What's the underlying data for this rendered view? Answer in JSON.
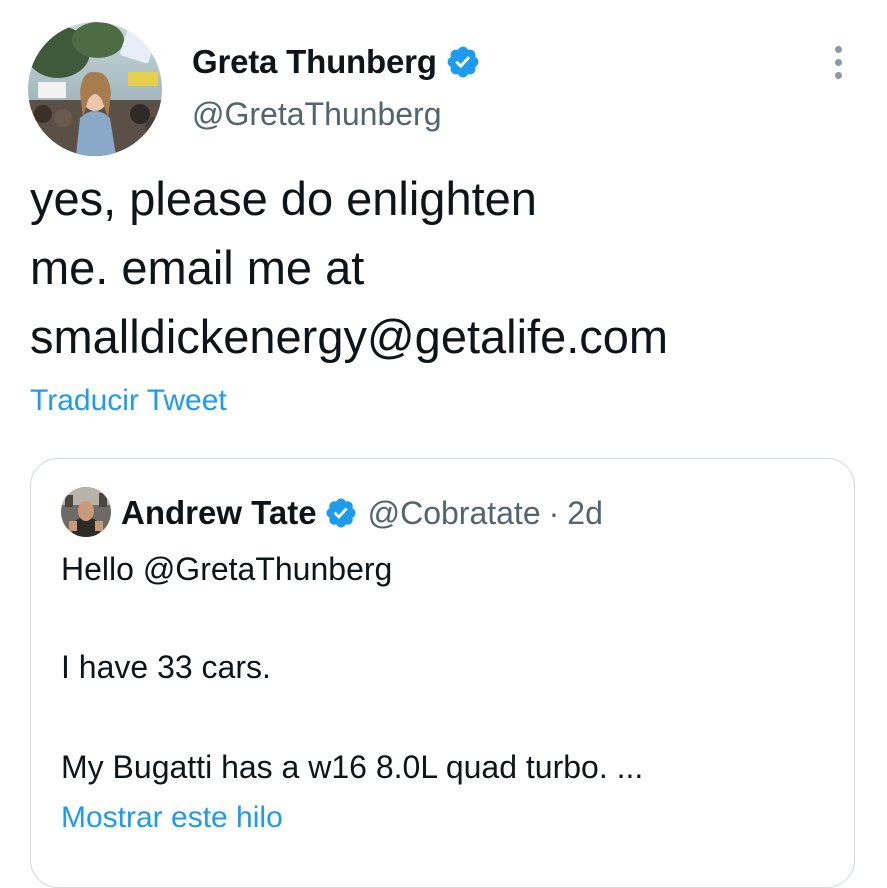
{
  "tweet": {
    "author": {
      "display_name": "Greta Thunberg",
      "handle": "@GretaThunberg",
      "verified": true,
      "avatar_icon": "profile-photo"
    },
    "text_lines": [
      "yes, please do enlighten",
      "me. email me at",
      "smalldickenergy@getalife.com"
    ],
    "translate_label": "Traducir Tweet",
    "more_icon": "more-vertical-icon"
  },
  "quoted_tweet": {
    "author": {
      "display_name": "Andrew Tate",
      "handle": "@Cobratate",
      "verified": true,
      "avatar_icon": "profile-photo"
    },
    "separator": "·",
    "time": "2d",
    "lines": [
      "Hello @GretaThunberg",
      "I have 33 cars.",
      "My Bugatti has a w16 8.0L quad turbo. ..."
    ],
    "show_thread_label": "Mostrar este hilo"
  },
  "colors": {
    "text": "#0f1419",
    "secondary": "#536471",
    "link": "#1d9bf0",
    "border": "#cfd9de",
    "verified": "#1d9bf0"
  }
}
